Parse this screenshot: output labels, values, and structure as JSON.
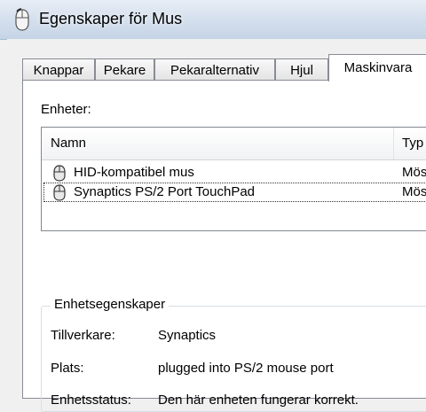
{
  "window": {
    "title": "Egenskaper för Mus",
    "icon": "mouse-icon"
  },
  "tabs": [
    {
      "label": "Knappar",
      "active": false
    },
    {
      "label": "Pekare",
      "active": false
    },
    {
      "label": "Pekaralternativ",
      "active": false
    },
    {
      "label": "Hjul",
      "active": false
    },
    {
      "label": "Maskinvara",
      "active": true
    }
  ],
  "devices": {
    "label": "Enheter:",
    "columns": {
      "name": "Namn",
      "type": "Typ"
    },
    "rows": [
      {
        "name": "HID-kompatibel mus",
        "type": "Mös",
        "icon": "mouse-icon",
        "selected": false
      },
      {
        "name": "Synaptics PS/2 Port TouchPad",
        "type": "Mös",
        "icon": "mouse-icon",
        "selected": true
      }
    ]
  },
  "properties": {
    "title": "Enhetsegenskaper",
    "items": [
      {
        "label": "Tillverkare:",
        "value": "Synaptics"
      },
      {
        "label": "Plats:",
        "value": "plugged into PS/2 mouse port"
      },
      {
        "label": "Enhetsstatus:",
        "value": "Den här enheten fungerar korrekt."
      }
    ]
  }
}
